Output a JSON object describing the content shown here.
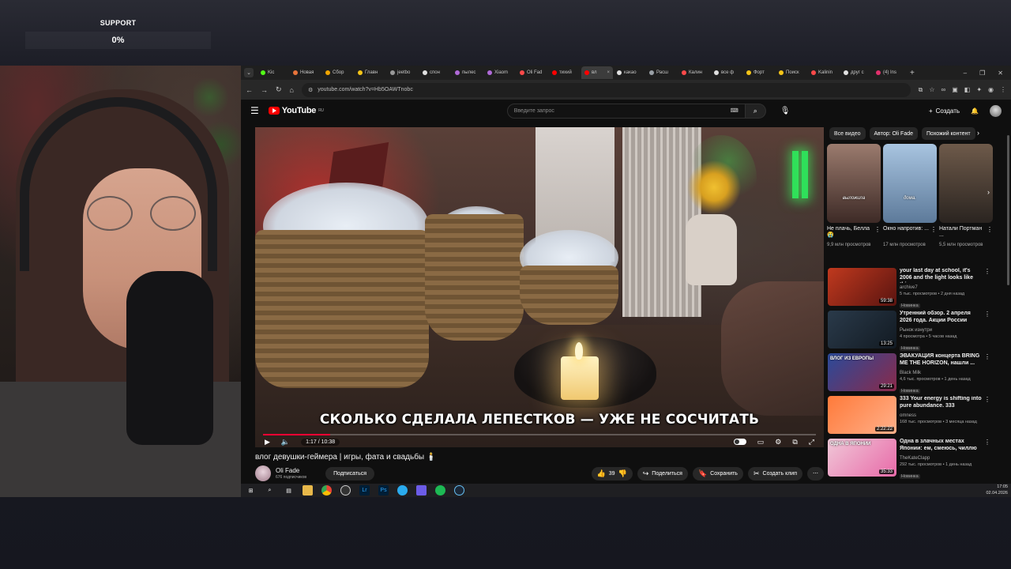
{
  "overlay": {
    "support_label": "SUPPORT",
    "support_value": "0%"
  },
  "browser": {
    "tabs": [
      {
        "label": "Kic",
        "color": "#53fc18"
      },
      {
        "label": "Новая",
        "color": "#e8743b"
      },
      {
        "label": "Сбор",
        "color": "#f0a500"
      },
      {
        "label": "Главн",
        "color": "#f5c518"
      },
      {
        "label": "jeetbo",
        "color": "#999999"
      },
      {
        "label": "спон",
        "color": "#e0e0e0"
      },
      {
        "label": "пылес",
        "color": "#b06ad8"
      },
      {
        "label": "Xiaom",
        "color": "#b06ad8"
      },
      {
        "label": "Oli Fad",
        "color": "#ff4a4a"
      },
      {
        "label": "тихий",
        "color": "#ff0000"
      },
      {
        "label": "вл",
        "color": "#ff0000"
      },
      {
        "label": "какао",
        "color": "#e0e0e0"
      },
      {
        "label": "Расш",
        "color": "#9aa0a6"
      },
      {
        "label": "Калин",
        "color": "#ff4a4a"
      },
      {
        "label": "все ф",
        "color": "#e0e0e0"
      },
      {
        "label": "Форт",
        "color": "#f5c518"
      },
      {
        "label": "Поиск",
        "color": "#f5c518"
      },
      {
        "label": "Kalinin",
        "color": "#ff4a4a"
      },
      {
        "label": "друг с",
        "color": "#e0e0e0"
      },
      {
        "label": "(4) Ins",
        "color": "#e1306c"
      }
    ],
    "active_tab_index": 10,
    "url": "youtube.com/watch?v=Hb5OAWTnobc"
  },
  "youtube": {
    "logo_text": "YouTube",
    "logo_region": "RU",
    "search_placeholder": "Введите запрос",
    "create_label": "Создать",
    "video": {
      "caption": "СКОЛЬКО СДЕЛАЛА ЛЕПЕСТКОВ — УЖЕ НЕ СОСЧИТАТЬ",
      "time": "1:17 / 10:38",
      "progress_fraction": 0.121,
      "title": "влог девушки-геймера | игры, фата и свадьбы 🕯️"
    },
    "channel": {
      "name": "Oli Fade",
      "subs": "676 подписчиков",
      "subscribe_label": "Подписаться"
    },
    "actions": {
      "likes": "39",
      "share": "Поделиться",
      "save": "Сохранить",
      "clip": "Создать клип",
      "more": "⋯"
    },
    "chips": [
      "Все видео",
      "Автор: Oli Fade",
      "Похожий контент"
    ],
    "shorts": [
      {
        "title": "Не плачь, Белла😭",
        "views": "9,9 млн просмотров",
        "overlay": "выложила",
        "colors": [
          "#9b7b6e",
          "#3d2a26"
        ]
      },
      {
        "title": "Окно напротив: ...",
        "views": "17 млн просмотров",
        "overlay": "дома.",
        "colors": [
          "#a8c4e0",
          "#5d7a9a"
        ]
      },
      {
        "title": "Натали Портман ...",
        "views": "5,5 млн просмотров",
        "overlay": "",
        "colors": [
          "#6e5a4a",
          "#2a2420"
        ]
      }
    ],
    "recommendations": [
      {
        "title": "your last day at school, it's 2006 and the light looks like this",
        "channel": "archive7",
        "views": "5 тыс. просмотров • 2 дня назад",
        "badge": "Новинка",
        "duration": "59:38",
        "colors": [
          "#c0391e",
          "#5a1410"
        ]
      },
      {
        "title": "Утренний обзор. 2 апреля 2026 года. Акции России",
        "channel": "Рынок изнутри",
        "views": "4 просмотра • 5 часов назад",
        "badge": "Новинка",
        "duration": "13:25",
        "colors": [
          "#2a3a4a",
          "#121a22"
        ]
      },
      {
        "title": "ЭВАКУАЦИЯ концерта BRING ME THE HORIZON, нашли ...",
        "channel": "Black Milk",
        "views": "4,6 тыс. просмотров • 1 день назад",
        "badge": "Новинка",
        "duration": "29:21",
        "colors": [
          "#2a4a9a",
          "#8a2a4a"
        ],
        "overlay": "ВЛОГ ИЗ ЕВРОПЫ"
      },
      {
        "title": "333 Your energy is shifting into pure abundance. 333",
        "channel": "omness",
        "views": "168 тыс. просмотров • 3 месяца назад",
        "badge": "",
        "duration": "2:22:22",
        "colors": [
          "#ff7a3a",
          "#ffb08a"
        ]
      },
      {
        "title": "Одна в злачных местах Японии: ем, смеюсь, чиллю",
        "channel": "TheKateClapp",
        "views": "292 тыс. просмотров • 1 день назад",
        "badge": "Новинка",
        "duration": "35:33",
        "colors": [
          "#f0c8d8",
          "#e86aa8"
        ],
        "overlay": "ОДНА В ЯПОНИИ"
      }
    ]
  },
  "taskbar": {
    "apps": [
      "start-icon",
      "search-icon",
      "task-view-icon",
      "explorer-icon",
      "chrome-icon",
      "obs-icon",
      "lightroom-icon",
      "photoshop-icon",
      "telegram-icon",
      "app-icon",
      "spotify-icon",
      "steam-icon"
    ],
    "time": "17:05",
    "date": "02.04.2026"
  }
}
